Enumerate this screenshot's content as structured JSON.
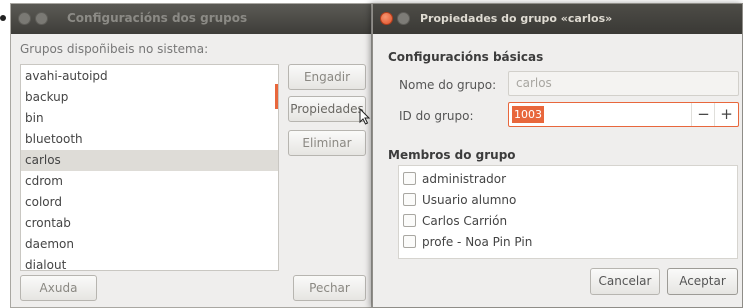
{
  "groups_window": {
    "title": "Configuracións dos grupos",
    "list_label": "Grupos dispoñibeis no sistema:",
    "groups": [
      "avahi-autoipd",
      "backup",
      "bin",
      "bluetooth",
      "carlos",
      "cdrom",
      "colord",
      "crontab",
      "daemon",
      "dialout"
    ],
    "selected_group": "carlos",
    "buttons": {
      "add": "Engadir",
      "properties": "Propiedades",
      "delete": "Eliminar",
      "help": "Axuda",
      "close": "Pechar"
    }
  },
  "properties_dialog": {
    "title": "Propiedades do grupo «carlos»",
    "basic_section": "Configuracións básicas",
    "name_label": "Nome do grupo:",
    "name_value": "carlos",
    "id_label": "ID do grupo:",
    "id_value": "1003",
    "minus": "−",
    "plus": "+",
    "members_section": "Membros do grupo",
    "members": [
      {
        "name": "administrador",
        "checked": false
      },
      {
        "name": "Usuario alumno",
        "checked": false
      },
      {
        "name": "Carlos Carrión",
        "checked": false
      },
      {
        "name": "profe - Noa Pin Pin",
        "checked": false
      }
    ],
    "buttons": {
      "cancel": "Cancelar",
      "accept": "Aceptar"
    }
  },
  "colors": {
    "accent": "#e8673c",
    "titlebar": "#3e3d39",
    "window_bg": "#efeeed"
  }
}
